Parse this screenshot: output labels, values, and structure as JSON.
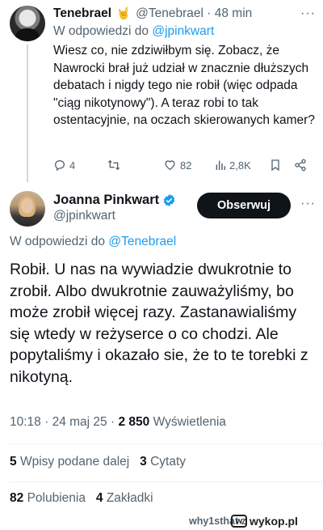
{
  "parent_tweet": {
    "author_name": "Tenebrael",
    "author_emoji": "🤘",
    "author_handle": "@Tenebrael",
    "separator": "·",
    "time": "48 min",
    "reply_prefix": "W odpowiedzi do",
    "reply_to": "@jpinkwart",
    "text": "Wiesz co, nie zdziwiłbym się. Zobacz, że Nawrocki brał już udział w znacznie dłuższych debatach i nigdy tego nie robił (więc odpada \"ciąg nikotynowy\"). A teraz robi to tak ostentacyjnie, na oczach skierowanych kamer?",
    "replies": "4",
    "retweets": "",
    "likes": "82",
    "views": "2,8K"
  },
  "main_tweet": {
    "author_name": "Joanna Pinkwart",
    "author_handle": "@jpinkwart",
    "follow_label": "Obserwuj",
    "reply_prefix": "W odpowiedzi do",
    "reply_to": "@Tenebrael",
    "text": "Robił. U nas na wywiadzie dwukrotnie to zrobił. Albo dwukrotnie zauważyliśmy, bo może zrobił więcej razy. Zastanawialiśmy się wtedy w reżyserce o co chodzi. Ale popytaliśmy i okazało sie, że to te torebki z nikotyną.",
    "time": "10:18",
    "dot": "·",
    "date": "24 maj 25",
    "dot2": "·",
    "views_count": "2 850",
    "views_label": "Wyświetlenia",
    "reposts_count": "5",
    "reposts_label": "Wpisy podane dalej",
    "quotes_count": "3",
    "quotes_label": "Cytaty",
    "likes_count": "82",
    "likes_label": "Polubienia",
    "bookmarks_count": "4",
    "bookmarks_label": "Zakładki"
  },
  "footer": {
    "uploader": "why1sthat z",
    "site": "wykop.pl"
  },
  "colors": {
    "accent": "#1d9bf0",
    "text": "#0f1419",
    "muted": "#536471",
    "border": "#eff3f4"
  }
}
